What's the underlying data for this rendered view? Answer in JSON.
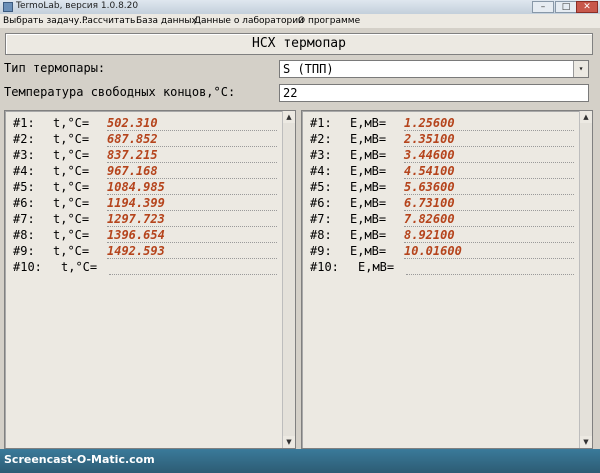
{
  "window": {
    "title": "TermoLab, версия 1.0.8.20",
    "min": "–",
    "max": "□",
    "close": "✕"
  },
  "menu": [
    "Выбрать задачу...",
    "Рассчитать",
    "База данных",
    "Данные о лаборатории",
    "О программе"
  ],
  "header": {
    "button_label": "НСХ термопар"
  },
  "form": {
    "thermocouple_label": "Тип термопары:",
    "thermocouple_value": "S (ТПП)",
    "free_end_label": "Температура свободных концов,°С:",
    "free_end_value": "22"
  },
  "left_rows": [
    {
      "idx": "#1:",
      "lab": "t,°C=",
      "val": "502.310"
    },
    {
      "idx": "#2:",
      "lab": "t,°C=",
      "val": "687.852"
    },
    {
      "idx": "#3:",
      "lab": "t,°C=",
      "val": "837.215"
    },
    {
      "idx": "#4:",
      "lab": "t,°C=",
      "val": "967.168"
    },
    {
      "idx": "#5:",
      "lab": "t,°C=",
      "val": "1084.985"
    },
    {
      "idx": "#6:",
      "lab": "t,°C=",
      "val": "1194.399"
    },
    {
      "idx": "#7:",
      "lab": "t,°C=",
      "val": "1297.723"
    },
    {
      "idx": "#8:",
      "lab": "t,°C=",
      "val": "1396.654"
    },
    {
      "idx": "#9:",
      "lab": "t,°C=",
      "val": "1492.593"
    },
    {
      "idx": "#10:",
      "lab": "t,°C=",
      "val": ""
    }
  ],
  "right_rows": [
    {
      "idx": "#1:",
      "lab": "E,мВ=",
      "val": "1.25600"
    },
    {
      "idx": "#2:",
      "lab": "E,мВ=",
      "val": "2.35100"
    },
    {
      "idx": "#3:",
      "lab": "E,мВ=",
      "val": "3.44600"
    },
    {
      "idx": "#4:",
      "lab": "E,мВ=",
      "val": "4.54100"
    },
    {
      "idx": "#5:",
      "lab": "E,мВ=",
      "val": "5.63600"
    },
    {
      "idx": "#6:",
      "lab": "E,мВ=",
      "val": "6.73100"
    },
    {
      "idx": "#7:",
      "lab": "E,мВ=",
      "val": "7.82600"
    },
    {
      "idx": "#8:",
      "lab": "E,мВ=",
      "val": "8.92100"
    },
    {
      "idx": "#9:",
      "lab": "E,мВ=",
      "val": "10.01600"
    },
    {
      "idx": "#10:",
      "lab": "E,мВ=",
      "val": ""
    }
  ],
  "icons": {
    "dropdown": "▾",
    "scroll_up": "▲",
    "scroll_down": "▼"
  },
  "watermark": "Screencast-O-Matic.com"
}
